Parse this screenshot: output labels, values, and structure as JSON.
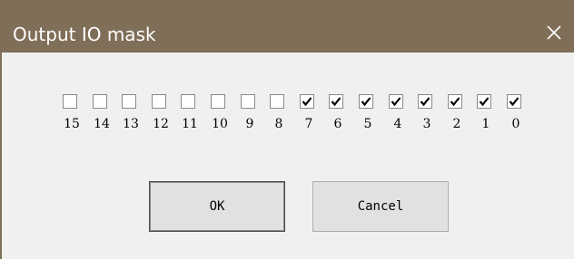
{
  "window": {
    "title": "Output IO mask",
    "close_icon": "close-icon"
  },
  "bits": [
    {
      "label": "15",
      "checked": false
    },
    {
      "label": "14",
      "checked": false
    },
    {
      "label": "13",
      "checked": false
    },
    {
      "label": "12",
      "checked": false
    },
    {
      "label": "11",
      "checked": false
    },
    {
      "label": "10",
      "checked": false
    },
    {
      "label": "9",
      "checked": false
    },
    {
      "label": "8",
      "checked": false
    },
    {
      "label": "7",
      "checked": true
    },
    {
      "label": "6",
      "checked": true
    },
    {
      "label": "5",
      "checked": true
    },
    {
      "label": "4",
      "checked": true
    },
    {
      "label": "3",
      "checked": true
    },
    {
      "label": "2",
      "checked": true
    },
    {
      "label": "1",
      "checked": true
    },
    {
      "label": "0",
      "checked": true
    }
  ],
  "buttons": {
    "ok_label": "OK",
    "cancel_label": "Cancel"
  },
  "colors": {
    "titlebar": "#7f6e58",
    "dialog_background": "#f0f0f0"
  }
}
